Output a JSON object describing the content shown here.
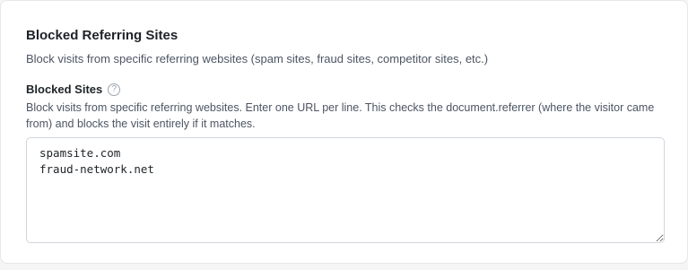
{
  "section": {
    "title": "Blocked Referring Sites",
    "description": "Block visits from specific referring websites (spam sites, fraud sites, competitor sites, etc.)"
  },
  "field": {
    "label": "Blocked Sites",
    "help_icon": "question-circle-icon",
    "help_icon_glyph": "?",
    "help_text": "Block visits from specific referring websites. Enter one URL per line. This checks the document.referrer (where the visitor came from) and blocks the visit entirely if it matches.",
    "value": "spamsite.com\nfraud-network.net"
  }
}
